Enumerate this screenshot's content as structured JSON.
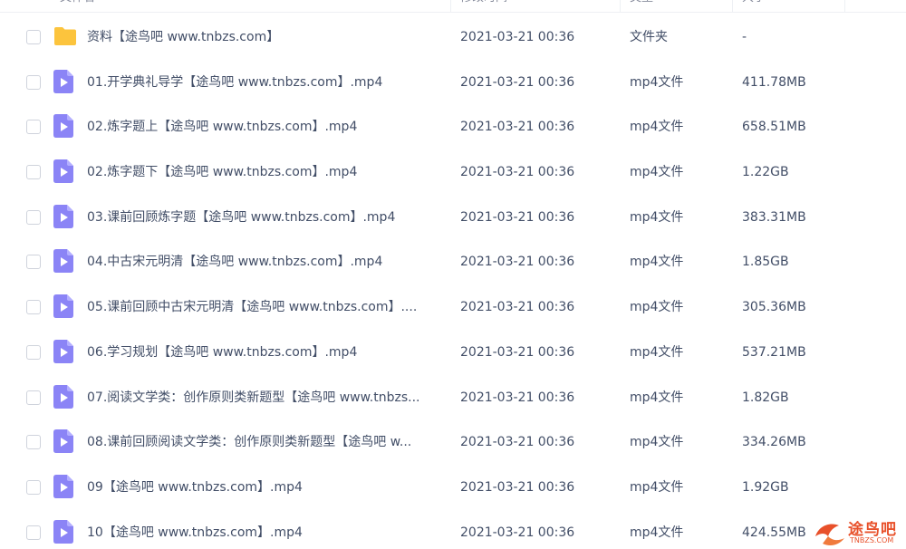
{
  "header": {
    "col_name": "文件名",
    "col_date": "修改时间",
    "col_type": "类型",
    "col_size": "大小"
  },
  "files": [
    {
      "icon": "folder-icon",
      "name": "资料【途鸟吧 www.tnbzs.com】",
      "date": "2021-03-21 00:36",
      "type": "文件夹",
      "size": "-"
    },
    {
      "icon": "video-file-icon",
      "name": "01.开学典礼导学【途鸟吧 www.tnbzs.com】.mp4",
      "date": "2021-03-21 00:36",
      "type": "mp4文件",
      "size": "411.78MB"
    },
    {
      "icon": "video-file-icon",
      "name": "02.炼字题上【途鸟吧 www.tnbzs.com】.mp4",
      "date": "2021-03-21 00:36",
      "type": "mp4文件",
      "size": "658.51MB"
    },
    {
      "icon": "video-file-icon",
      "name": "02.炼字题下【途鸟吧 www.tnbzs.com】.mp4",
      "date": "2021-03-21 00:36",
      "type": "mp4文件",
      "size": "1.22GB"
    },
    {
      "icon": "video-file-icon",
      "name": "03.课前回顾炼字题【途鸟吧 www.tnbzs.com】.mp4",
      "date": "2021-03-21 00:36",
      "type": "mp4文件",
      "size": "383.31MB"
    },
    {
      "icon": "video-file-icon",
      "name": "04.中古宋元明清【途鸟吧 www.tnbzs.com】.mp4",
      "date": "2021-03-21 00:36",
      "type": "mp4文件",
      "size": "1.85GB"
    },
    {
      "icon": "video-file-icon",
      "name": "05.课前回顾中古宋元明清【途鸟吧 www.tnbzs.com】....",
      "date": "2021-03-21 00:36",
      "type": "mp4文件",
      "size": "305.36MB"
    },
    {
      "icon": "video-file-icon",
      "name": "06.学习规划【途鸟吧 www.tnbzs.com】.mp4",
      "date": "2021-03-21 00:36",
      "type": "mp4文件",
      "size": "537.21MB"
    },
    {
      "icon": "video-file-icon",
      "name": "07.阅读文学类：创作原则类新题型【途鸟吧 www.tnbzs...",
      "date": "2021-03-21 00:36",
      "type": "mp4文件",
      "size": "1.82GB"
    },
    {
      "icon": "video-file-icon",
      "name": "08.课前回顾阅读文学类：创作原则类新题型【途鸟吧 w...",
      "date": "2021-03-21 00:36",
      "type": "mp4文件",
      "size": "334.26MB"
    },
    {
      "icon": "video-file-icon",
      "name": "09【途鸟吧 www.tnbzs.com】.mp4",
      "date": "2021-03-21 00:36",
      "type": "mp4文件",
      "size": "1.92GB"
    },
    {
      "icon": "video-file-icon",
      "name": "10【途鸟吧 www.tnbzs.com】.mp4",
      "date": "2021-03-21 00:36",
      "type": "mp4文件",
      "size": "424.55MB"
    }
  ],
  "watermark": {
    "title": "途鸟吧",
    "url": "TNBZS.COM"
  },
  "colors": {
    "folder": "#fcc43d",
    "video_icon": "#8b84f6",
    "text": "#424e67",
    "watermark": "#e8502a"
  }
}
